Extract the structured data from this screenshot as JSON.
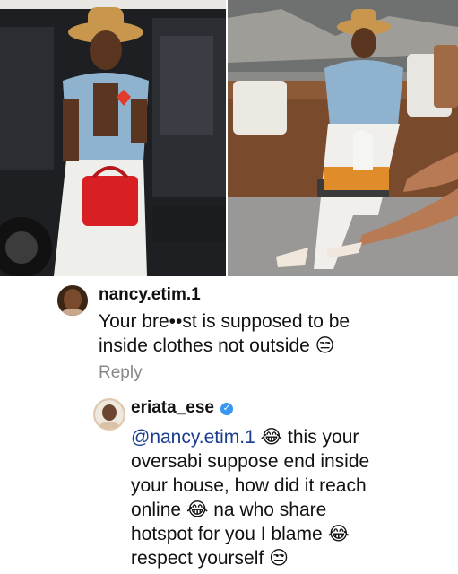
{
  "comments": [
    {
      "username": "nancy.etim.1",
      "text": "Your bre••st is supposed to be\ninside clothes not outside 😒",
      "reply_label": "Reply"
    },
    {
      "username": "eriata_ese",
      "verified": true,
      "mention": "@nancy.etim.1",
      "text": " 😂 this your\noversabi suppose end inside\nyour house, how did it reach\nonline 😂 na who share\nhotspot for you I blame 😂\nrespect yourself 😒"
    }
  ],
  "icons": {
    "verified": "verified-badge-icon",
    "avatar_1": "avatar",
    "avatar_2": "avatar"
  },
  "colors": {
    "verified": "#3897f0",
    "mention": "#1b3d8f",
    "reply": "#888888"
  }
}
